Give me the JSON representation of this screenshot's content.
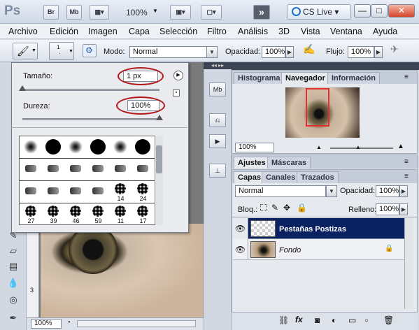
{
  "titlebar": {
    "app_logo": "Ps",
    "bridge_label": "Br",
    "minibridge_label": "Mb",
    "zoom": "100%",
    "cs_live": "CS Live",
    "cs_live_arrow": "▾",
    "workspace_icon": "double-chevron-icon"
  },
  "menu": [
    "Archivo",
    "Edición",
    "Imagen",
    "Capa",
    "Selección",
    "Filtro",
    "Análisis",
    "3D",
    "Vista",
    "Ventana",
    "Ayuda"
  ],
  "options": {
    "brush_size_badge": "1",
    "mode_label": "Modo:",
    "mode_value": "Normal",
    "opacity_label": "Opacidad:",
    "opacity_value": "100%",
    "flow_label": "Flujo:",
    "flow_value": "100%"
  },
  "brush_popup": {
    "size_label": "Tamaño:",
    "size_value": "1 px",
    "hardness_label": "Dureza:",
    "hardness_value": "100%",
    "size_slider_fraction": 0.0,
    "hardness_slider_fraction": 1.0,
    "presets": [
      {
        "kind": "soft",
        "label": ""
      },
      {
        "kind": "hard",
        "label": ""
      },
      {
        "kind": "soft",
        "label": ""
      },
      {
        "kind": "hard",
        "label": ""
      },
      {
        "kind": "soft",
        "label": ""
      },
      {
        "kind": "hard",
        "label": ""
      },
      {
        "kind": "tip",
        "label": ""
      },
      {
        "kind": "tip",
        "label": ""
      },
      {
        "kind": "tip",
        "label": ""
      },
      {
        "kind": "tip",
        "label": ""
      },
      {
        "kind": "tip",
        "label": ""
      },
      {
        "kind": "tip",
        "label": ""
      },
      {
        "kind": "tip",
        "label": ""
      },
      {
        "kind": "tip",
        "label": ""
      },
      {
        "kind": "tip",
        "label": ""
      },
      {
        "kind": "tip",
        "label": ""
      },
      {
        "kind": "splat",
        "label": "14"
      },
      {
        "kind": "splat",
        "label": "24"
      },
      {
        "kind": "splat",
        "label": "27"
      },
      {
        "kind": "splat",
        "label": "39"
      },
      {
        "kind": "splat",
        "label": "46"
      },
      {
        "kind": "splat",
        "label": "59"
      },
      {
        "kind": "splat",
        "label": "11"
      },
      {
        "kind": "splat",
        "label": "17"
      }
    ]
  },
  "canvas": {
    "zoom_status": "100%",
    "ruler_mark": "3"
  },
  "navigator_panel": {
    "tabs": [
      "Histograma",
      "Navegador",
      "Información"
    ],
    "active_tab": "Navegador",
    "zoom_value": "100%"
  },
  "adjust_panel": {
    "tabs": [
      "Ajustes",
      "Máscaras"
    ],
    "active_tab": "Ajustes"
  },
  "layers_panel": {
    "tabs": [
      "Capas",
      "Canales",
      "Trazados"
    ],
    "active_tab": "Capas",
    "blend_mode": "Normal",
    "opacity_label": "Opacidad:",
    "opacity_value": "100%",
    "lock_label": "Bloq.:",
    "fill_label": "Relleno:",
    "fill_value": "100%",
    "layers": [
      {
        "name": "Pestañas Postizas",
        "selected": true,
        "locked": false
      },
      {
        "name": "Fondo",
        "selected": false,
        "locked": true
      }
    ]
  },
  "colors": {
    "selection_blue": "#0b2262",
    "highlight_red": "#b21a1a",
    "navigator_box": "#e23030"
  }
}
